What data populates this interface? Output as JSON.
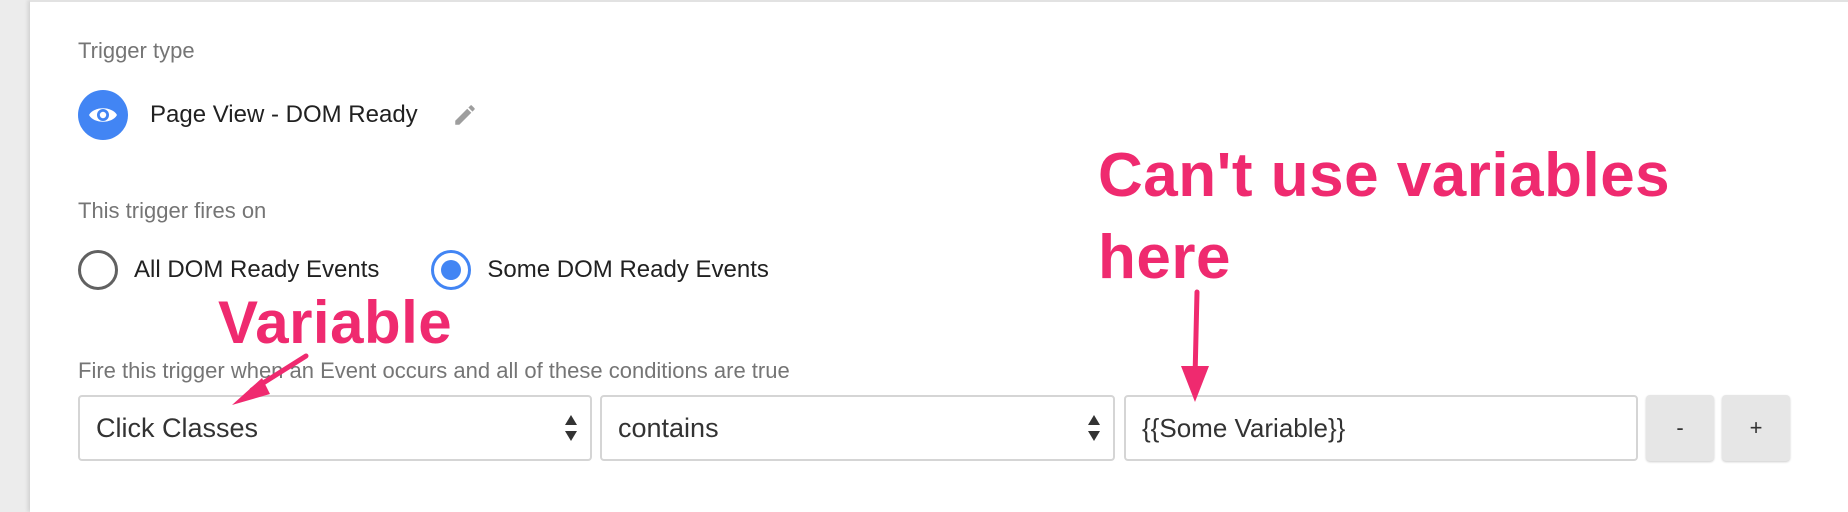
{
  "trigger_type": {
    "label": "Trigger type",
    "name": "Page View - DOM Ready",
    "icon": "eye-icon",
    "edit_icon": "pencil-icon",
    "accent": "#4285f4"
  },
  "fires_on": {
    "label": "This trigger fires on",
    "options": [
      {
        "label": "All DOM Ready Events",
        "selected": false
      },
      {
        "label": "Some DOM Ready Events",
        "selected": true
      }
    ]
  },
  "conditions": {
    "label": "Fire this trigger when an Event occurs and all of these conditions are true",
    "variable": "Click Classes",
    "operator": "contains",
    "value": "{{Some Variable}}",
    "remove_label": "-",
    "add_label": "+"
  },
  "annotations": {
    "variable": "Variable",
    "cant_use_line1": "Can't use variables",
    "cant_use_line2": "here",
    "color": "#ef2a6f"
  }
}
